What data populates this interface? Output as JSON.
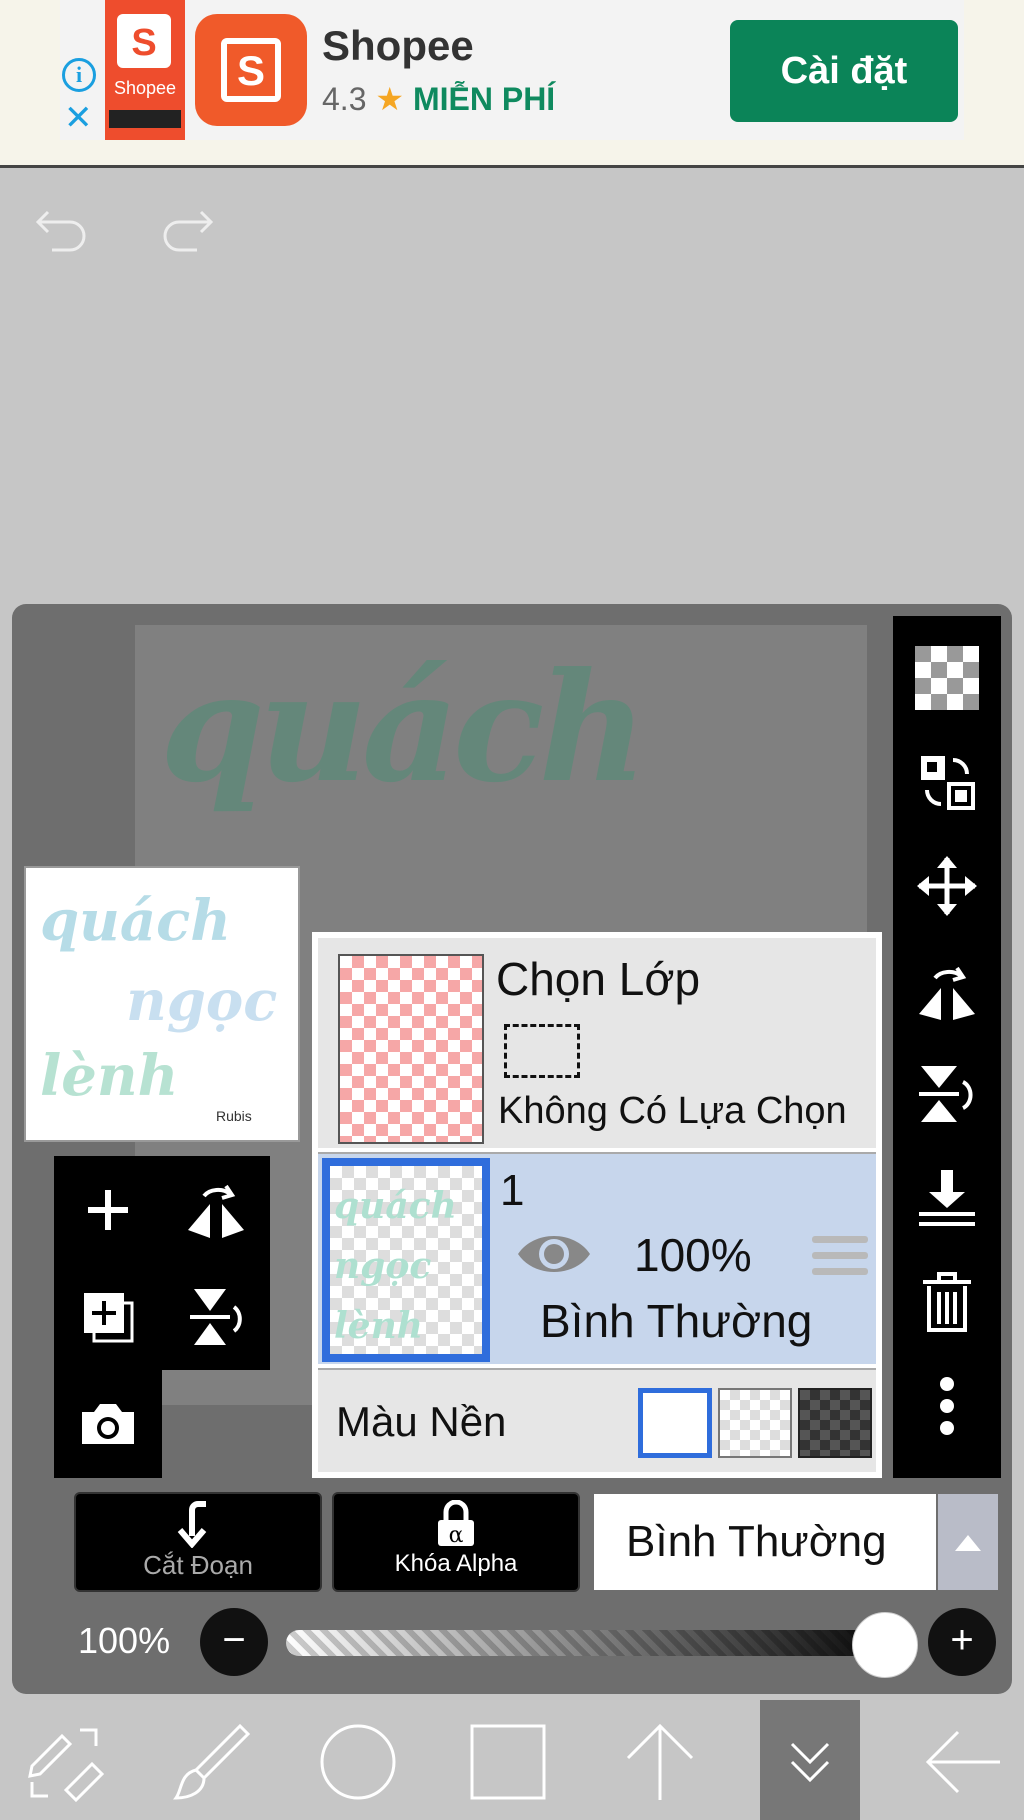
{
  "ad": {
    "thumb_label": "Shopee",
    "app_name": "Shopee",
    "rating": "4.3",
    "star": "★",
    "price": "MIỄN PHÍ",
    "install_button": "Cài đặt",
    "brand_color": "#ee4d2d",
    "install_color": "#0b8458",
    "info_icon": "i",
    "close_icon": "✕",
    "logo_letter": "S"
  },
  "toolbar": {
    "undo_icon": "undo-icon",
    "redo_icon": "redo-icon"
  },
  "canvas": {
    "art_text": "quách",
    "thumb_lines": [
      "quách",
      "ngọc",
      "lènh"
    ],
    "thumb_signature": "Rubis"
  },
  "layer_panel": {
    "selection_title": "Chọn Lớp",
    "selection_status": "Không Có Lựa Chọn",
    "layer_number": "1",
    "layer_opacity": "100%",
    "layer_blend_mode": "Bình Thường",
    "background_label": "Màu Nền",
    "layer_thumb_text": "quách ngọc lènh",
    "accent_color": "#2f6ddc"
  },
  "actions": {
    "clipping_label": "Cắt Đoạn",
    "alpha_lock_label": "Khóa Alpha",
    "alpha_symbol": "α",
    "blend_mode_value": "Bình Thường",
    "blend_arrow": "▲"
  },
  "opacity": {
    "label": "100%",
    "value": 100,
    "minus": "−",
    "plus": "+"
  },
  "right_toolbar": [
    "transparent-layer-icon",
    "swap-layer-icon",
    "move-icon",
    "flip-horizontal-icon",
    "flip-vertical-icon",
    "merge-down-icon",
    "delete-icon",
    "more-icon"
  ],
  "bottom_toolbar": [
    "transform-tool-icon",
    "brush-icon",
    "circle-icon",
    "square-icon",
    "arrow-up-icon",
    "chevron-down-icon",
    "back-arrow-icon"
  ]
}
